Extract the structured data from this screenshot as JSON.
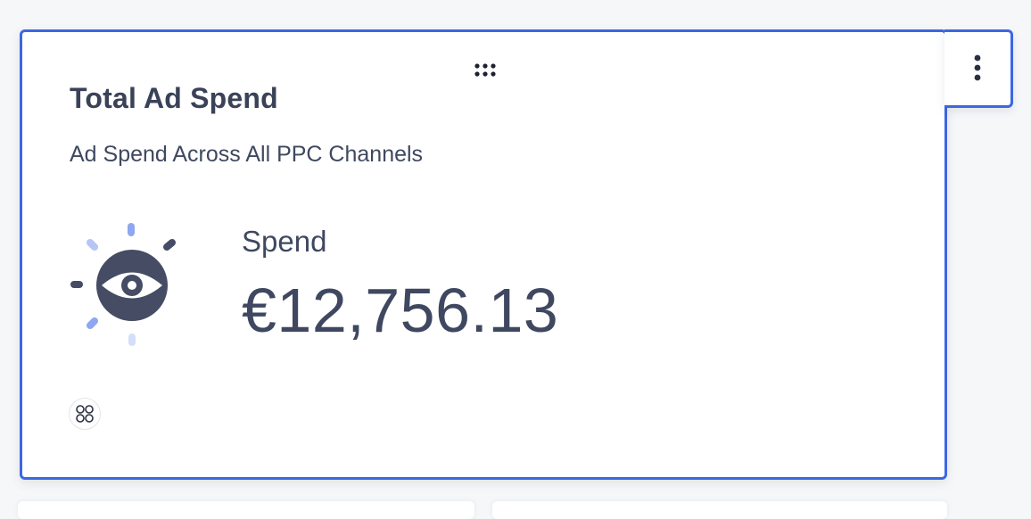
{
  "widget": {
    "title": "Total Ad Spend",
    "subtitle": "Ad Spend Across All PPC Channels",
    "metric": {
      "label": "Spend",
      "value": "€12,756.13",
      "icon": "eye-icon"
    },
    "integration_icon": "integration-icon"
  },
  "controls": {
    "drag_icon": "drag-handle-icon",
    "menu_icon": "more-vertical-icon"
  },
  "colors": {
    "accent_border": "#3b67e3",
    "text_primary": "#3a4258",
    "icon_dark": "#454c63",
    "icon_light_blue": "#9db2f2"
  }
}
